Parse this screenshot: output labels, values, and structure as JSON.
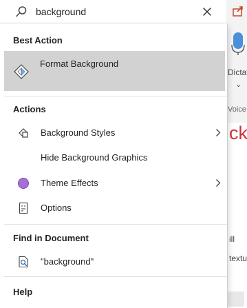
{
  "search": {
    "query": "background",
    "clear_icon": "close-icon"
  },
  "best_action": {
    "header": "Best Action",
    "item": {
      "label": "Format Background",
      "icon": "format-background-icon"
    }
  },
  "actions": {
    "header": "Actions",
    "items": [
      {
        "label": "Background Styles",
        "icon": "background-styles-icon",
        "has_submenu": true
      },
      {
        "label": "Hide Background Graphics",
        "icon": "",
        "has_submenu": false
      },
      {
        "label": "Theme Effects",
        "icon": "theme-effects-icon",
        "has_submenu": true
      },
      {
        "label": "Options",
        "icon": "options-icon",
        "has_submenu": false
      }
    ]
  },
  "find_in_document": {
    "header": "Find in Document",
    "item": {
      "label": "\"background\"",
      "icon": "document-search-icon"
    }
  },
  "help": {
    "header": "Help"
  },
  "background_app": {
    "dictate_label": "Dictat",
    "voice_label": "Voice",
    "slide_fragment": "ckg",
    "fragment_ill": "ill",
    "fragment_textu": "textu"
  },
  "colors": {
    "hover_background": "#d2d2d2",
    "theme_effects_fill": "#a470d8",
    "accent_red": "#d13438",
    "mic_blue": "#4a90d9"
  }
}
